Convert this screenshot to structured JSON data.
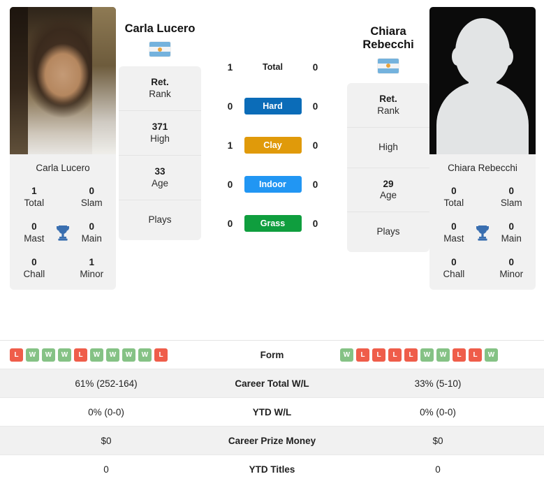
{
  "colors": {
    "hard": "#0b6cb8",
    "clay": "#e09a0a",
    "indoor": "#2196f3",
    "grass": "#0f9e3e",
    "win": "#85c285",
    "loss": "#ef5d4a",
    "trophy": "#3a6fb0",
    "panel": "#f1f1f1"
  },
  "players": {
    "left": {
      "name": "Carla Lucero",
      "country": "Argentina",
      "flag_icon": "argentina-flag-icon",
      "photo_alt": "Carla Lucero",
      "card_name": "Carla Lucero",
      "titles": [
        {
          "value": "1",
          "label": "Total"
        },
        {
          "value": "0",
          "label": "Slam"
        },
        {
          "value": "0",
          "label": "Mast"
        },
        {
          "value": "0",
          "label": "Main"
        },
        {
          "value": "0",
          "label": "Chall"
        },
        {
          "value": "1",
          "label": "Minor"
        }
      ],
      "rank": {
        "value": "Ret.",
        "label": "Rank"
      },
      "high": {
        "value": "371",
        "label": "High"
      },
      "age": {
        "value": "33",
        "label": "Age"
      },
      "plays": {
        "value": "",
        "label": "Plays"
      },
      "form": [
        "L",
        "W",
        "W",
        "W",
        "L",
        "W",
        "W",
        "W",
        "W",
        "L"
      ],
      "career_wl": "61% (252-164)",
      "ytd_wl": "0% (0-0)",
      "prize_money": "$0",
      "ytd_titles": "0",
      "surface_counts": {
        "total": "1",
        "hard": "0",
        "clay": "1",
        "indoor": "0",
        "grass": "0"
      }
    },
    "right": {
      "name": "Chiara Rebecchi",
      "name_line1": "Chiara",
      "name_line2": "Rebecchi",
      "country": "Argentina",
      "flag_icon": "argentina-flag-icon",
      "photo_alt": "Chiara Rebecchi",
      "card_name": "Chiara Rebecchi",
      "titles": [
        {
          "value": "0",
          "label": "Total"
        },
        {
          "value": "0",
          "label": "Slam"
        },
        {
          "value": "0",
          "label": "Mast"
        },
        {
          "value": "0",
          "label": "Main"
        },
        {
          "value": "0",
          "label": "Chall"
        },
        {
          "value": "0",
          "label": "Minor"
        }
      ],
      "rank": {
        "value": "Ret.",
        "label": "Rank"
      },
      "high": {
        "value": "",
        "label": "High"
      },
      "age": {
        "value": "29",
        "label": "Age"
      },
      "plays": {
        "value": "",
        "label": "Plays"
      },
      "form": [
        "W",
        "L",
        "L",
        "L",
        "L",
        "W",
        "W",
        "L",
        "L",
        "W"
      ],
      "career_wl": "33% (5-10)",
      "ytd_wl": "0% (0-0)",
      "prize_money": "$0",
      "ytd_titles": "0",
      "surface_counts": {
        "total": "0",
        "hard": "0",
        "clay": "0",
        "indoor": "0",
        "grass": "0"
      }
    }
  },
  "surfaces": {
    "total_label": "Total",
    "hard_label": "Hard",
    "clay_label": "Clay",
    "indoor_label": "Indoor",
    "grass_label": "Grass"
  },
  "table_labels": {
    "form": "Form",
    "career_wl": "Career Total W/L",
    "ytd_wl": "YTD W/L",
    "prize_money": "Career Prize Money",
    "ytd_titles": "YTD Titles"
  }
}
